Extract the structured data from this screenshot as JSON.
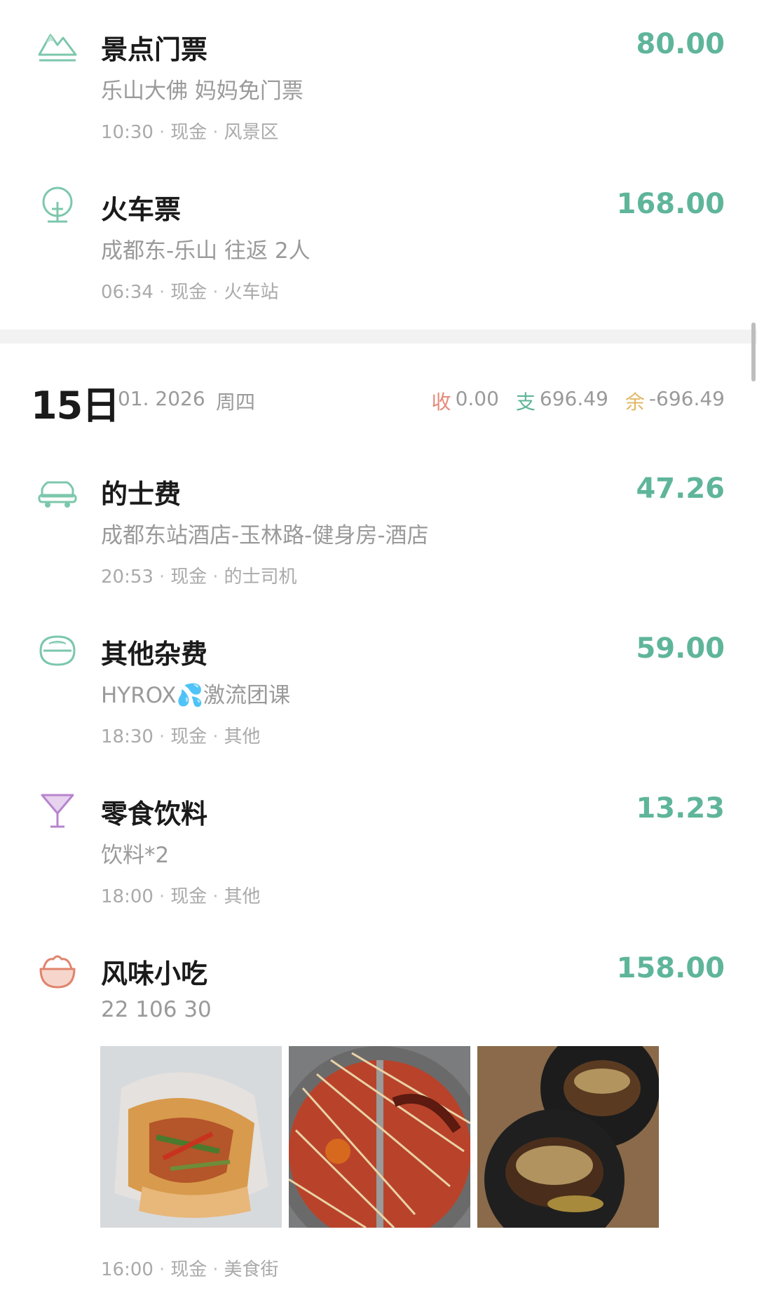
{
  "colors": {
    "accent_green": "#5fb59a",
    "income": "#e58a7a",
    "expense": "#5fb59a",
    "balance": "#e2b766",
    "muted": "#9a9a9a"
  },
  "top_entries": [
    {
      "icon": "mountain-icon",
      "title": "景点门票",
      "amount": "80.00",
      "note": "乐山大佛 妈妈免门票",
      "time": "10:30",
      "account": "现金",
      "place": "风景区"
    },
    {
      "icon": "tree-icon",
      "title": "火车票",
      "amount": "168.00",
      "note": "成都东-乐山 往返 2人",
      "time": "06:34",
      "account": "现金",
      "place": "火车站"
    }
  ],
  "day": {
    "number": "15日",
    "month": "01. 2026",
    "weekday": "周四",
    "income_label": "收",
    "income": "0.00",
    "expense_label": "支",
    "expense": "696.49",
    "balance_label": "余",
    "balance": "-696.49"
  },
  "entries": [
    {
      "icon": "car-icon",
      "title": "的士费",
      "amount": "47.26",
      "note": "成都东站酒店-玉林路-健身房-酒店",
      "time": "20:53",
      "account": "现金",
      "place": "的士司机"
    },
    {
      "icon": "cap-icon",
      "title": "其他杂费",
      "amount": "59.00",
      "note": "HYROX💦激流团课",
      "time": "18:30",
      "account": "现金",
      "place": "其他"
    },
    {
      "icon": "cocktail-icon",
      "title": "零食饮料",
      "amount": "13.23",
      "note": "饮料*2",
      "time": "18:00",
      "account": "现金",
      "place": "其他"
    },
    {
      "icon": "bun-icon",
      "title": "风味小吃",
      "amount": "158.00",
      "note": "22 106 30",
      "time": "16:00",
      "account": "现金",
      "place": "美食街"
    }
  ],
  "photos": [
    "food-photo-1",
    "food-photo-2",
    "food-photo-3"
  ]
}
